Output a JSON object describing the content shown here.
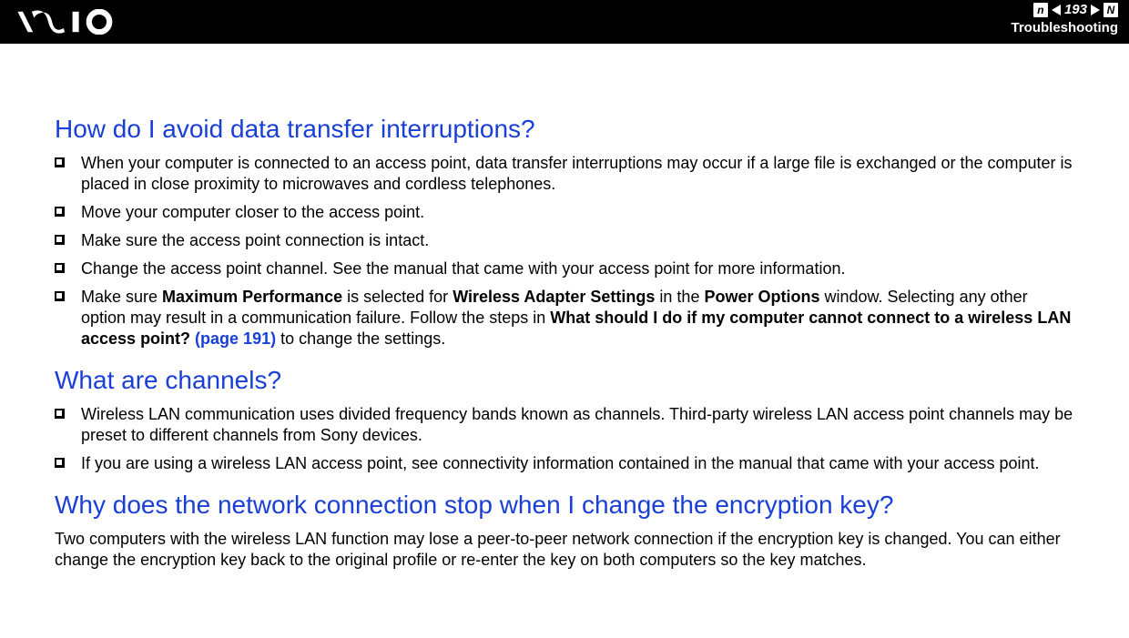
{
  "header": {
    "page_number": "193",
    "section": "Troubleshooting",
    "nav_letter_left": "n",
    "nav_letter_right": "N"
  },
  "sections": [
    {
      "title": "How do I avoid data transfer interruptions?",
      "bullets": [
        {
          "runs": [
            {
              "t": "When your computer is connected to an access point, data transfer interruptions may occur if a large file is exchanged or the computer is placed in close proximity to microwaves and cordless telephones."
            }
          ]
        },
        {
          "runs": [
            {
              "t": "Move your computer closer to the access point."
            }
          ]
        },
        {
          "runs": [
            {
              "t": "Make sure the access point connection is intact."
            }
          ]
        },
        {
          "runs": [
            {
              "t": "Change the access point channel. See the manual that came with your access point for more information."
            }
          ]
        },
        {
          "runs": [
            {
              "t": "Make sure "
            },
            {
              "t": "Maximum Performance",
              "b": true
            },
            {
              "t": " is selected for "
            },
            {
              "t": "Wireless Adapter Settings",
              "b": true
            },
            {
              "t": " in the "
            },
            {
              "t": "Power Options",
              "b": true
            },
            {
              "t": " window. Selecting any other option may result in a communication failure. Follow the steps in "
            },
            {
              "t": "What should I do if my computer cannot connect to a wireless LAN access point? ",
              "b": true
            },
            {
              "t": "(page 191)",
              "link": true,
              "b": true
            },
            {
              "t": " to change the settings."
            }
          ]
        }
      ]
    },
    {
      "title": "What are channels?",
      "bullets": [
        {
          "runs": [
            {
              "t": "Wireless LAN communication uses divided frequency bands known as channels. Third-party wireless LAN access point channels may be preset to different channels from Sony devices."
            }
          ]
        },
        {
          "runs": [
            {
              "t": "If you are using a wireless LAN access point, see connectivity information contained in the manual that came with your access point."
            }
          ]
        }
      ]
    },
    {
      "title": "Why does the network connection stop when I change the encryption key?",
      "paragraph": {
        "runs": [
          {
            "t": "Two computers with the wireless LAN function may lose a peer-to-peer network connection if the encryption key is changed. You can either change the encryption key back to the original profile or re-enter the key on both computers so the key matches."
          }
        ]
      }
    }
  ]
}
